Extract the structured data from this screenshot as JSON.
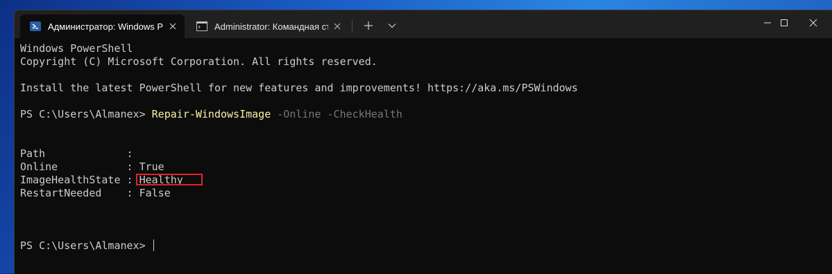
{
  "tabs": [
    {
      "label": "Администратор: Windows Pow",
      "icon": "powershell-icon",
      "active": true
    },
    {
      "label": "Administrator: Командная стро",
      "icon": "cmd-icon",
      "active": false
    }
  ],
  "titlebar": {
    "new_tab": "+",
    "dropdown": "chevron-down-icon"
  },
  "window_controls": [
    "minimize-icon",
    "maximize-icon",
    "close-icon"
  ],
  "console": {
    "header_title": "Windows PowerShell",
    "copyright": "Copyright (C) Microsoft Corporation. All rights reserved.",
    "install_notice": "Install the latest PowerShell for new features and improvements! https://aka.ms/PSWindows",
    "prompt": "PS C:\\Users\\Almanex> ",
    "command": "Repair-WindowsImage",
    "command_params": " -Online -CheckHealth",
    "output": [
      {
        "key": "Path             ",
        "sep": ": ",
        "value": ""
      },
      {
        "key": "Online           ",
        "sep": ": ",
        "value": "True"
      },
      {
        "key": "ImageHealthState ",
        "sep": ": ",
        "value": "Healthy"
      },
      {
        "key": "RestartNeeded    ",
        "sep": ": ",
        "value": "False"
      }
    ],
    "final_prompt": "PS C:\\Users\\Almanex> "
  },
  "colors": {
    "command": "#f9f1a5",
    "param": "#767676",
    "text": "#cccccc",
    "highlight_box": "#e8202a"
  }
}
